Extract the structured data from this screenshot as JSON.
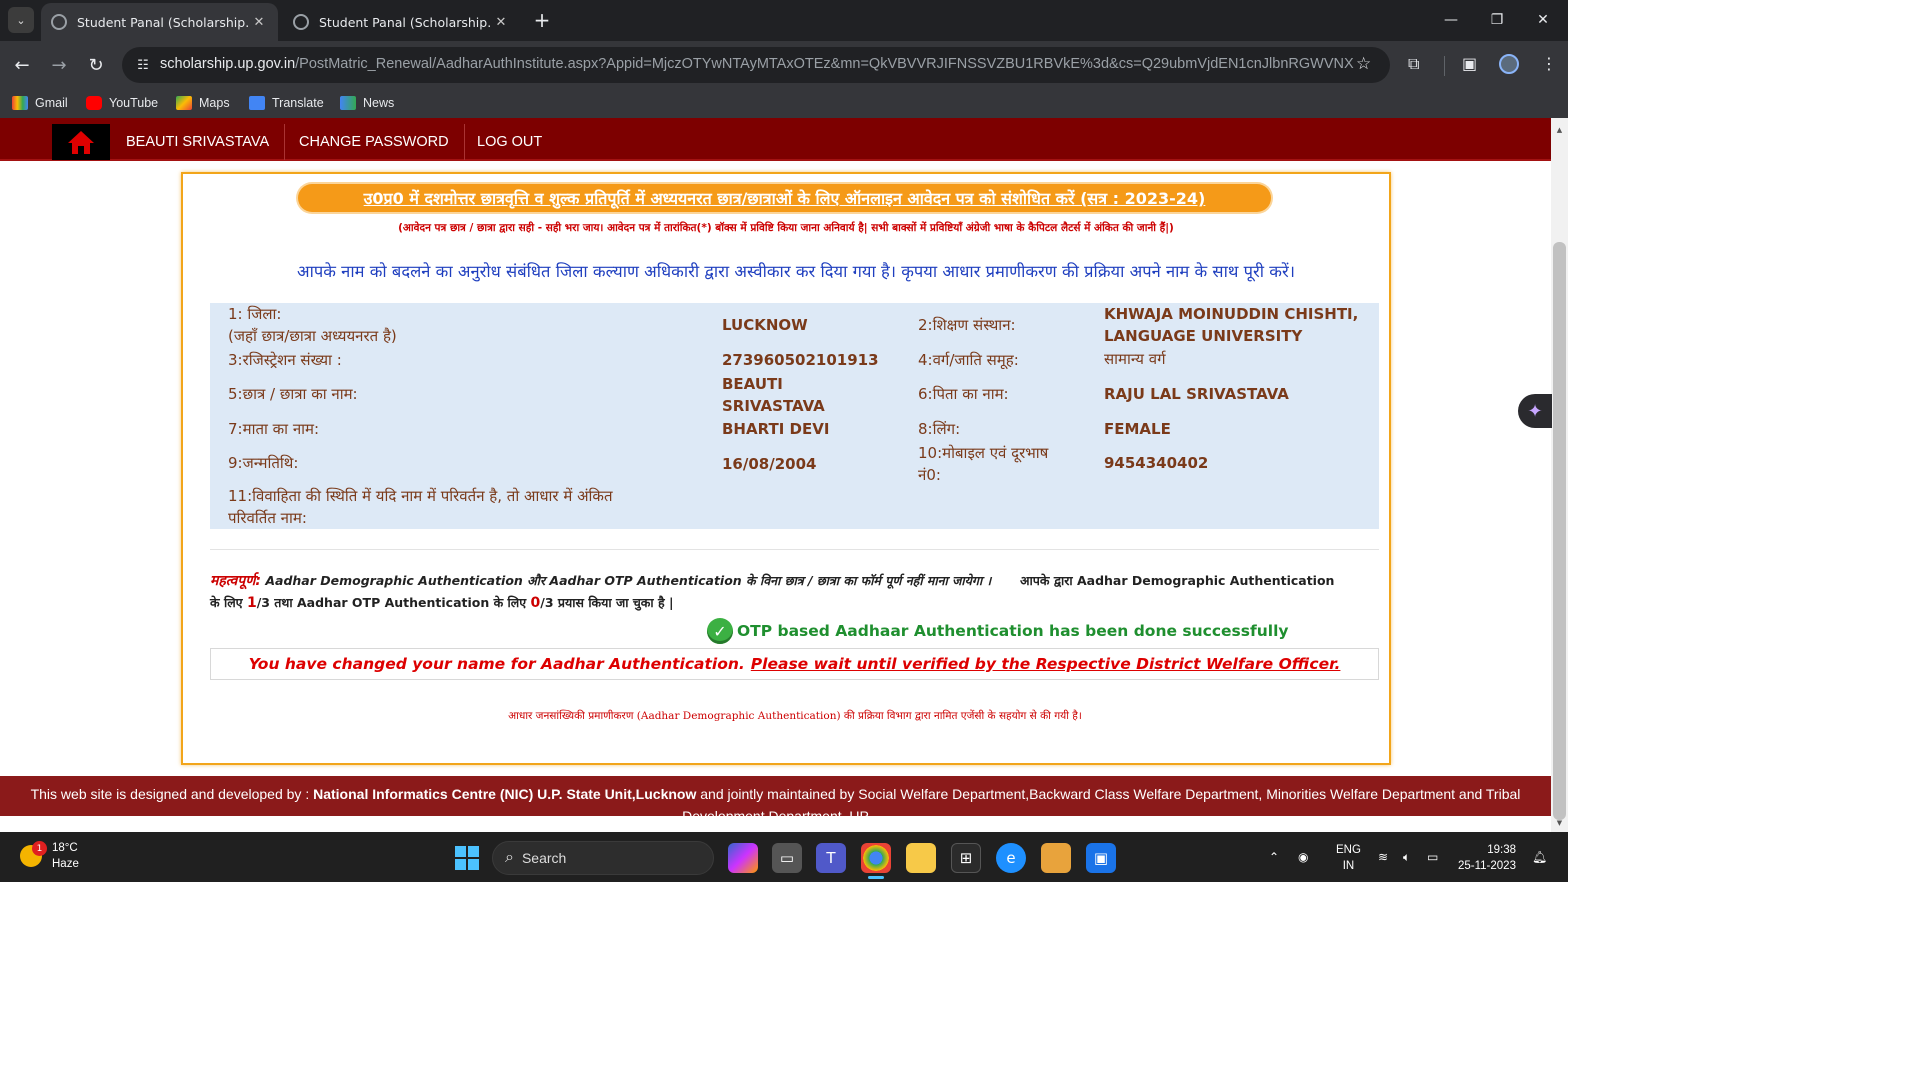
{
  "browser": {
    "tabs": [
      {
        "title": "Student Panal (Scholarship.up.n"
      },
      {
        "title": "Student Panal (Scholarship.up.n"
      }
    ],
    "url_host": "scholarship.up.gov.in",
    "url_path": "/PostMatric_Renewal/AadharAuthInstitute.aspx?Appid=MjczOTYwNTAyMTAxOTEz&mn=QkVBVVRJIFNSSVZBU1RBVkE%3d&cs=Q29ubmVjdEN1cnJlbnRGWVNX",
    "bookmarks": [
      "Gmail",
      "YouTube",
      "Maps",
      "Translate",
      "News"
    ]
  },
  "nav": {
    "user": "BEAUTI SRIVASTAVA",
    "change_password": "CHANGE PASSWORD",
    "logout": "LOG OUT"
  },
  "form": {
    "heading": "उ0प्र0 में दशमोत्तर छात्रवृत्ति व शुल्क प्रतिपूर्ति में अध्ययनरत छात्र/छात्राओं के लिए ऑनलाइन आवेदन पत्र को संशोधित करें (सत्र : 2023-24)",
    "instruction": "(आवेदन पत्र छात्र / छात्रा द्वारा सही - सही भरा जाय। आवेदन पत्र में तारांकित(*) बॉक्स में प्रविष्टि किया जाना अनिवार्य है| सभी बाक्सों में प्रविष्टियाँ अंग्रेजी भाषा के कैपिटल लैटर्स में अंकित की जानी हैं|)",
    "rejection_notice": "आपके नाम को बदलने का अनुरोध संबंधित जिला कल्याण अधिकारी द्वारा अस्वीकार कर दिया गया है। कृपया आधार प्रमाणीकरण की प्रक्रिया अपने नाम के साथ पूरी करें।",
    "fields": {
      "district_label_1": "1: जिला:",
      "district_label_2": "(जहाँ छात्र/छात्रा अध्ययनरत है)",
      "district": "LUCKNOW",
      "institution_label": "2:शिक्षण संस्थान:",
      "institution_1": "KHWAJA MOINUDDIN CHISHTI,",
      "institution_2": "LANGUAGE UNIVERSITY",
      "registration_label": "3:रजिस्ट्रेशन संख्या :",
      "registration": "273960502101913",
      "category_label": "4:वर्ग/जाति समूह:",
      "category": "सामान्य वर्ग",
      "student_label": "5:छात्र / छात्रा का नाम:",
      "student_1": "BEAUTI",
      "student_2": "SRIVASTAVA",
      "father_label": "6:पिता का नाम:",
      "father": "RAJU LAL SRIVASTAVA",
      "mother_label": "7:माता का नाम:",
      "mother": "BHARTI DEVI",
      "gender_label": "8:लिंग:",
      "gender": "FEMALE",
      "dob_label": "9:जन्मतिथि:",
      "dob": "16/08/2004",
      "mobile_label_1": "10:मोबाइल एवं दूरभाष",
      "mobile_label_2": "नं0:",
      "mobile": "9454340402",
      "married_label_1": "11:विवाहिता की स्थिति में यदि नाम में परिवर्तन है, तो आधार में अंकित",
      "married_label_2": "परिवर्तित नाम:"
    },
    "important_label": "महत्वपूर्ण:",
    "important_text_1": "Aadhar Demographic Authentication और Aadhar OTP Authentication के विना छात्र / छात्रा का फॉर्म पूर्ण नहीं माना जायेगा ।",
    "important_text_2": "आपके द्वारा Aadhar Demographic Authentication",
    "important_text_3": "के लिए",
    "demo_attempts": "1",
    "important_text_4": "/3 तथा Aadhar OTP Authentication के लिए",
    "otp_attempts": "0",
    "important_text_5": "/3 प्रयास किया जा चुका है |",
    "otp_success": "OTP based Aadhaar Authentication has been done successfully",
    "changed_name": "You have changed your name for Aadhar Authentication.",
    "wait_link": "Please wait until verified by the Respective District Welfare Officer.",
    "aadhar_note": "आधार जनसांख्यिकी प्रमाणीकरण (Aadhar Demographic Authentication) की प्रक्रिया विभाग द्वारा नामित एजेंसी के सहयोग से की गयी है।"
  },
  "footer": {
    "prefix": "This web site is designed and developed by :",
    "nic": "National Informatics Centre (NIC) U.P. State Unit,Lucknow",
    "suffix": "and jointly maintained by Social Welfare Department,Backward Class Welfare Department, Minorities Welfare Department and Tribal",
    "line2": "Development Department, UP"
  },
  "taskbar": {
    "temp": "18°C",
    "weather": "Haze",
    "weather_badge": "1",
    "search": "Search",
    "lang_1": "ENG",
    "lang_2": "IN",
    "time": "19:38",
    "date": "25-11-2023"
  }
}
